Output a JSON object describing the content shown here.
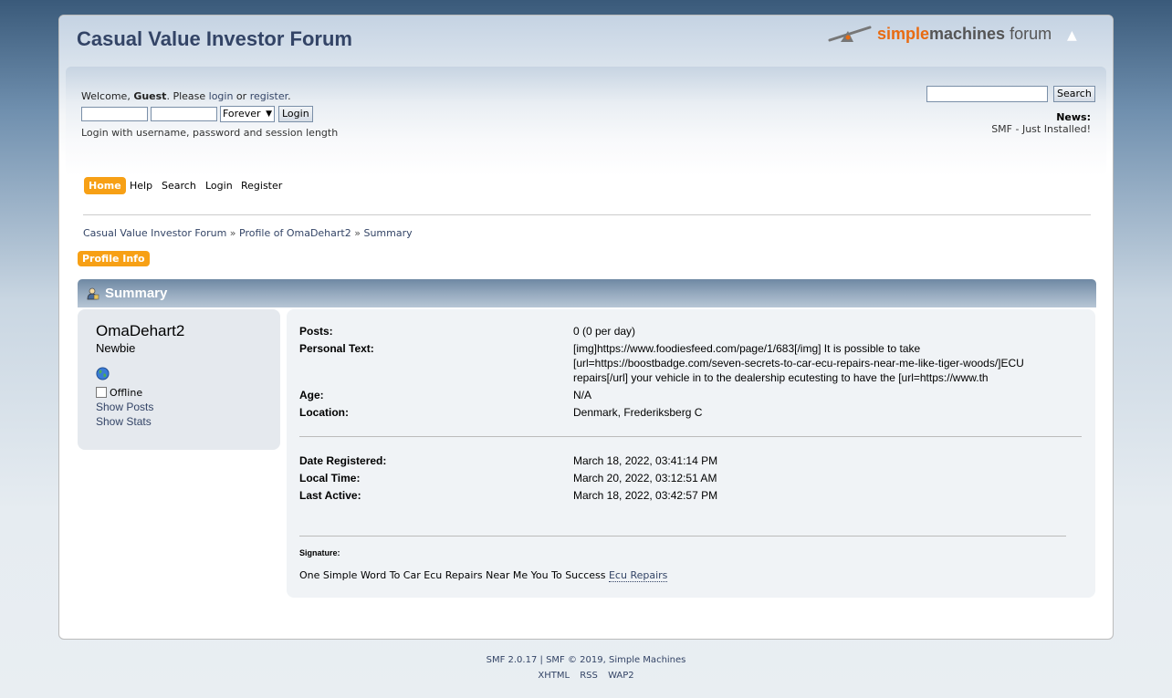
{
  "forum": {
    "title": "Casual Value Investor Forum"
  },
  "logo": {
    "simple": "simple",
    "machines": "machines",
    "forum": "forum"
  },
  "user_section": {
    "welcome_prefix": "Welcome, ",
    "guest": "Guest",
    "please": ". Please ",
    "login_link": "login",
    "or": " or ",
    "register_link": "register",
    "period": ".",
    "session_length": "Forever",
    "login_button": "Login",
    "login_hint": "Login with username, password and session length",
    "search_button": "Search",
    "news_label": "News:",
    "news_text": "SMF - Just Installed!"
  },
  "menu": {
    "items": [
      "Home",
      "Help",
      "Search",
      "Login",
      "Register"
    ]
  },
  "breadcrumb": {
    "items": [
      "Casual Value Investor Forum",
      "Profile of OmaDehart2",
      "Summary"
    ],
    "sep": "»"
  },
  "profile_tab": "Profile Info",
  "category": {
    "title": "Summary"
  },
  "profile": {
    "username": "OmaDehart2",
    "rank": "Newbie",
    "status": "Offline",
    "show_posts": "Show Posts",
    "show_stats": "Show Stats"
  },
  "summary": {
    "posts_label": "Posts:",
    "posts_value": "0 (0 per day)",
    "personal_text_label": "Personal Text:",
    "personal_text_value": "[img]https://www.foodiesfeed.com/page/1/683[/img] It is possible to take [url=https://boostbadge.com/seven-secrets-to-car-ecu-repairs-near-me-like-tiger-woods/]ECU repairs[/url] your vehicle in to the dealership ecutesting to have the [url=https://www.th",
    "age_label": "Age:",
    "age_value": "N/A",
    "location_label": "Location:",
    "location_value": "Denmark, Frederiksberg C",
    "registered_label": "Date Registered:",
    "registered_value": "March 18, 2022, 03:41:14 PM",
    "local_time_label": "Local Time:",
    "local_time_value": "March 20, 2022, 03:12:51 AM",
    "last_active_label": "Last Active:",
    "last_active_value": "March 18, 2022, 03:42:57 PM",
    "signature_label": "Signature:",
    "signature_text": "One Simple Word To Car Ecu Repairs Near Me You To Success ",
    "signature_link": "Ecu Repairs"
  },
  "footer": {
    "smf_version": "SMF 2.0.17",
    "bar": "|",
    "smf_copyright": "SMF © 2019",
    "comma": ",",
    "simple_machines": "Simple Machines",
    "xhtml": "XHTML",
    "rss": "RSS",
    "wap2": "WAP2"
  }
}
